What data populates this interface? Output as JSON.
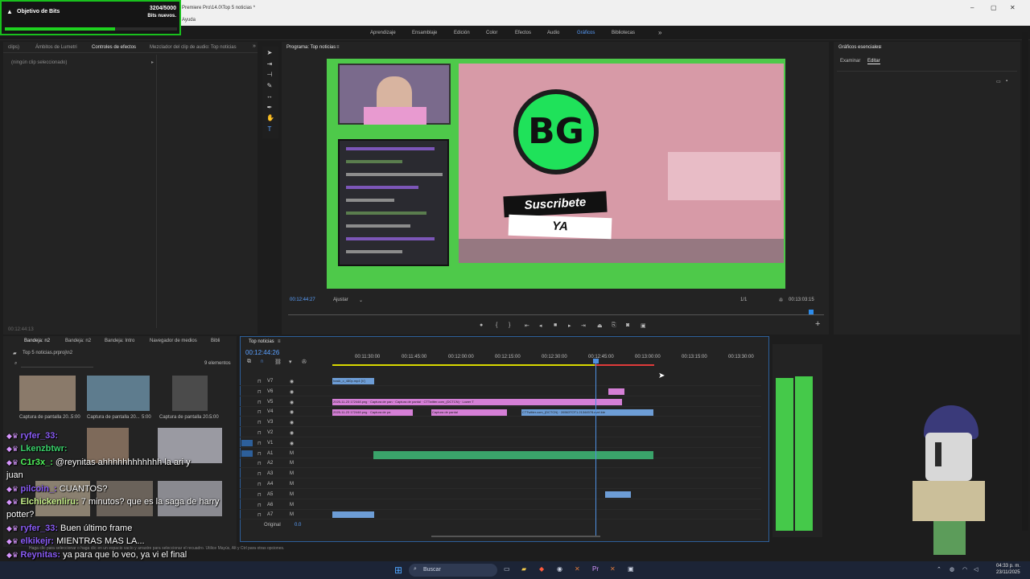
{
  "window": {
    "title": "Premiere Pro\\14.0\\Top 5 noticias *",
    "menu": "Ayuda",
    "controls": [
      "–",
      "▢",
      "✕"
    ]
  },
  "workspaces": [
    "Aprendizaje",
    "Ensamblaje",
    "Edición",
    "Color",
    "Efectos",
    "Audio",
    "Gráficos",
    "Bibliotecas"
  ],
  "active_workspace": "Gráficos",
  "bits_goal": {
    "title": "Objetivo de Bits",
    "count": "3204/5000",
    "subtitle": "Bits nuevos.",
    "progress": 0.64
  },
  "left_panel": {
    "tabs": [
      "clips)",
      "Ámbitos de Lumetri",
      "Controles de efectos",
      "Mezclador del clip de audio: Top noticias"
    ],
    "active_tab": "Controles de efectos",
    "placeholder": "(ningún clip seleccionado)",
    "timecode": "00:12:44:13"
  },
  "program": {
    "title": "Programa: Top noticias",
    "timecode": "00:12:44:27",
    "fit": "Ajustar",
    "ratio": "1/1",
    "duration": "00:13:03:15",
    "subscribe_line1": "Suscribete",
    "subscribe_line2": "YA",
    "logo": "BG"
  },
  "essential_graphics": {
    "title": "Gráficos esenciales",
    "tabs": [
      "Examinar",
      "Editar"
    ],
    "active_tab": "Editar"
  },
  "project_panel": {
    "tabs": [
      "Bandeja: n2",
      "Bandeja: n2",
      "Bandeja: Intro",
      "Navegador de medios",
      "Bibli"
    ],
    "path": "Top 5 noticias.prproj\\n2",
    "count": "9 elementos",
    "thumbs": [
      {
        "name": "Captura de pantalla 20...",
        "dur": "5:00"
      },
      {
        "name": "Captura de pantalla 20...",
        "dur": "5:00"
      },
      {
        "name": "Captura de pantalla 20...",
        "dur": "5:00"
      }
    ]
  },
  "timeline": {
    "title": "Top noticias",
    "timecode": "00:12:44:26",
    "ruler": [
      "00:11:30:00",
      "00:11:45:00",
      "00:12:00:00",
      "00:12:15:00",
      "00:12:30:00",
      "00:12:45:00",
      "00:13:00:00",
      "00:13:15:00",
      "00:13:30:00"
    ],
    "video_tracks": [
      "V7",
      "V6",
      "V5",
      "V4",
      "V3",
      "V2",
      "V1"
    ],
    "audio_tracks": [
      "A1",
      "A2",
      "A3",
      "A4",
      "A5",
      "A6",
      "A7"
    ],
    "mix_label": "Original",
    "mix_value": "0.0"
  },
  "chat": [
    {
      "user": "ryfer_33",
      "msg": ""
    },
    {
      "user": "Lkenzbtwr",
      "msg": ""
    },
    {
      "user": "C1r3x_",
      "msg": "@reynitas ahhhhhhhhhhhh la ari y"
    },
    {
      "user": "",
      "msg": "juan"
    },
    {
      "user": "pilcoin_",
      "msg": "CUANTOS?"
    },
    {
      "user": "Elchickenliru",
      "msg": "7 minutos? que es la saga de harry"
    },
    {
      "user": "",
      "msg": "potter?"
    },
    {
      "user": "ryfer_33",
      "msg": "Buen último frame"
    },
    {
      "user": "elkikejr",
      "msg": "MIENTRAS MAS LA..."
    },
    {
      "user": "Reynitas",
      "msg": "ya para que lo veo, ya vi el final"
    }
  ],
  "status_hint": "Haga clic para seleccionar o haga clic en un espacio vacío y arrastre para seleccionar el recuadro. Utilice Mayús, Alt y Ctrl para otras opciones.",
  "taskbar": {
    "search": "Buscar",
    "time": "04:33 p. m.",
    "date": "23/11/2025"
  },
  "colors": {
    "accent_blue": "#2d8ceb",
    "green_screen": "#4ec94a",
    "clip_pink": "#d57fd6",
    "clip_blue": "#6d9dd6",
    "audio_green": "#3aa36a",
    "playhead": "#4e8fe0"
  }
}
